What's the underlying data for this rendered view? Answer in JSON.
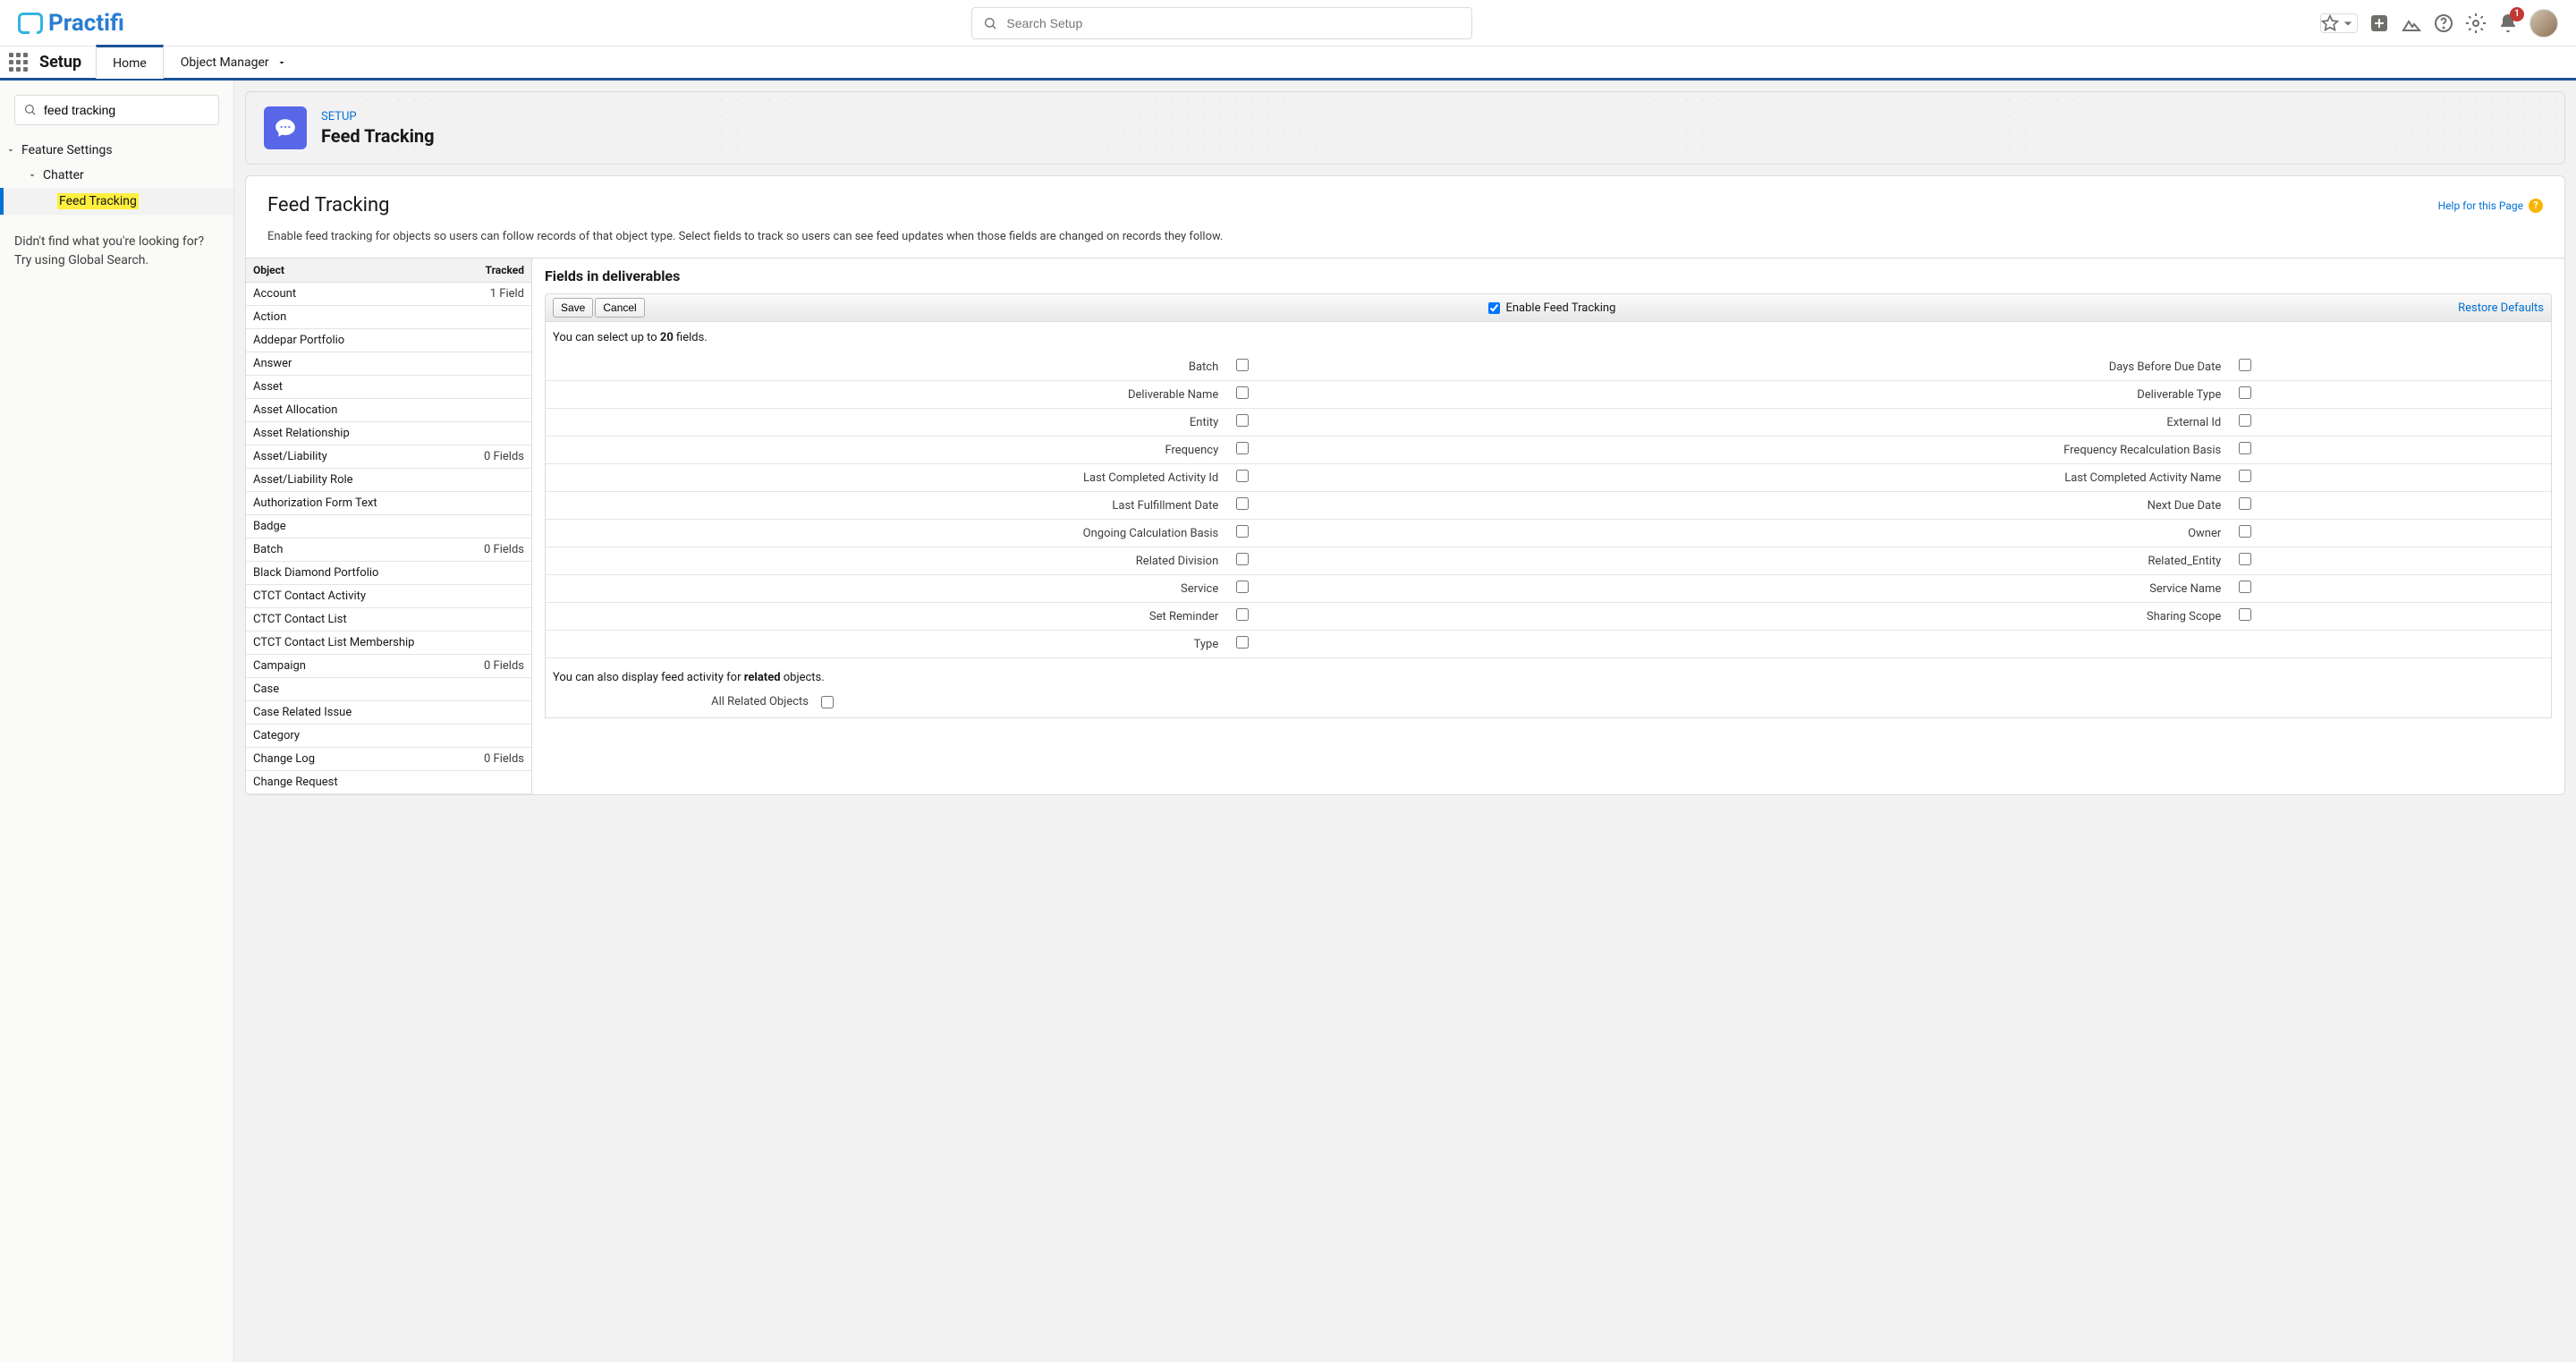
{
  "header": {
    "logo_text": "Practifi",
    "search_placeholder": "Search Setup",
    "notification_count": "1"
  },
  "nav": {
    "app_title": "Setup",
    "tab_home": "Home",
    "tab_object_manager": "Object Manager"
  },
  "sidebar": {
    "search_value": "feed tracking",
    "tree": {
      "feature_settings": "Feature Settings",
      "chatter": "Chatter",
      "feed_tracking": "Feed Tracking"
    },
    "hint_line1": "Didn't find what you're looking for?",
    "hint_line2": "Try using Global Search."
  },
  "page": {
    "breadcrumb": "SETUP",
    "title": "Feed Tracking",
    "content_heading": "Feed Tracking",
    "help_link": "Help for this Page",
    "description": "Enable feed tracking for objects so users can follow records of that object type. Select fields to track so users can see feed updates when those fields are changed on records they follow."
  },
  "object_table": {
    "col_object": "Object",
    "col_tracked": "Tracked",
    "rows": [
      {
        "name": "Account",
        "tracked": "1 Field"
      },
      {
        "name": "Action",
        "tracked": ""
      },
      {
        "name": "Addepar Portfolio",
        "tracked": ""
      },
      {
        "name": "Answer",
        "tracked": ""
      },
      {
        "name": "Asset",
        "tracked": ""
      },
      {
        "name": "Asset Allocation",
        "tracked": ""
      },
      {
        "name": "Asset Relationship",
        "tracked": ""
      },
      {
        "name": "Asset/Liability",
        "tracked": "0 Fields"
      },
      {
        "name": "Asset/Liability Role",
        "tracked": ""
      },
      {
        "name": "Authorization Form Text",
        "tracked": ""
      },
      {
        "name": "Badge",
        "tracked": ""
      },
      {
        "name": "Batch",
        "tracked": "0 Fields"
      },
      {
        "name": "Black Diamond Portfolio",
        "tracked": ""
      },
      {
        "name": "CTCT Contact Activity",
        "tracked": ""
      },
      {
        "name": "CTCT Contact List",
        "tracked": ""
      },
      {
        "name": "CTCT Contact List Membership",
        "tracked": ""
      },
      {
        "name": "Campaign",
        "tracked": "0 Fields"
      },
      {
        "name": "Case",
        "tracked": ""
      },
      {
        "name": "Case Related Issue",
        "tracked": ""
      },
      {
        "name": "Category",
        "tracked": ""
      },
      {
        "name": "Change Log",
        "tracked": "0 Fields"
      },
      {
        "name": "Change Request",
        "tracked": ""
      }
    ]
  },
  "fields_panel": {
    "heading": "Fields in deliverables",
    "save_label": "Save",
    "cancel_label": "Cancel",
    "enable_label": "Enable Feed Tracking",
    "restore_label": "Restore Defaults",
    "select_note_pre": "You can select up to ",
    "select_note_count": "20",
    "select_note_post": " fields.",
    "fields": [
      {
        "l": "Batch",
        "r": "Days Before Due Date"
      },
      {
        "l": "Deliverable Name",
        "r": "Deliverable Type"
      },
      {
        "l": "Entity",
        "r": "External Id"
      },
      {
        "l": "Frequency",
        "r": "Frequency Recalculation Basis"
      },
      {
        "l": "Last Completed Activity Id",
        "r": "Last Completed Activity Name"
      },
      {
        "l": "Last Fulfillment Date",
        "r": "Next Due Date"
      },
      {
        "l": "Ongoing Calculation Basis",
        "r": "Owner"
      },
      {
        "l": "Related Division",
        "r": "Related_Entity"
      },
      {
        "l": "Service",
        "r": "Service Name"
      },
      {
        "l": "Set Reminder",
        "r": "Sharing Scope"
      },
      {
        "l": "Type",
        "r": ""
      }
    ],
    "related_note_pre": "You can also display feed activity for ",
    "related_note_bold": "related",
    "related_note_post": " objects.",
    "all_related_label": "All Related Objects"
  }
}
